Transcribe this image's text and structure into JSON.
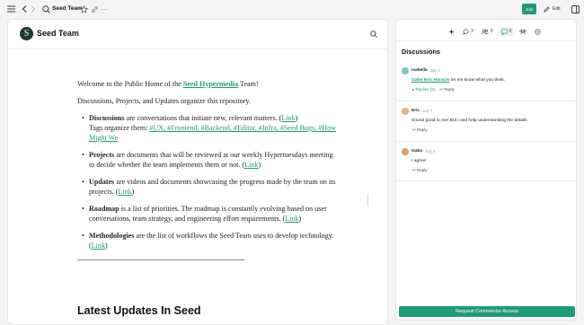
{
  "topbar": {
    "title": "Seed Team",
    "join_label": "Join",
    "edit_label": "Edit"
  },
  "header": {
    "logo_letter": "S",
    "site_name": "Seed Team"
  },
  "doc": {
    "intro_prefix": "Welcome to the Public Home of the ",
    "intro_link": "Seed Hypermedia",
    "intro_suffix": " Team!",
    "subtitle": "Discussions, Projects, and Updates organize this repository.",
    "items": [
      {
        "term": "Discussions",
        "text": " are conversations that initiate new, relevant matters. (",
        "link": "Link",
        "after": ")"
      },
      {
        "term": "Projects",
        "text": " are documents that will be reviewed at our weekly Hypertuesdays meeting to decide whether the team implements them or not. (",
        "link": "Link",
        "after": ")"
      },
      {
        "term": "Updates",
        "text": " are videos and documents showcasing the progress made by the team on its projects. (",
        "link": "Link",
        "after": ")"
      },
      {
        "term": "Roadmap",
        "text": " is a list of priorities. The roadmap is constantly evolving based on user conversations, team strategy, and engineering effort requirements. (",
        "link": "Link",
        "after": ")"
      },
      {
        "term": "Methodologies",
        "text": " are the list of workflows the Seed Team uses to develop technology. (",
        "link": "Link",
        "after": ")"
      }
    ],
    "tags_prefix": "Tags organize them: ",
    "tags": "#UX, #Frontend, #Backend, #Editor, #Infra, #Seed Bugs, #How Might We",
    "latest_heading": "Latest Updates In Seed"
  },
  "side": {
    "stats": [
      {
        "icon": "comment-icon",
        "count": "3"
      },
      {
        "icon": "users-icon",
        "count": "9"
      },
      {
        "icon": "discussion-icon",
        "count": "6"
      }
    ],
    "title": "Discussions",
    "comments": [
      {
        "name": "Isabella",
        "date": "July 1",
        "mention": "Gabo Eric Horacio",
        "body": " let me know what you think.",
        "replies": "Replies (2)",
        "reply": "Reply",
        "avatar_color": "#7cc7c0"
      },
      {
        "name": "Eric",
        "date": "July 7",
        "body": "Sound good to me! But I sed help understanding the details.",
        "reply": "Reply",
        "avatar_color": "#e2b27a"
      },
      {
        "name": "Gabo",
        "date": "July 9",
        "body": "I agree!",
        "reply": "Reply",
        "avatar_color": "#d9a07a"
      }
    ],
    "request_label": "Request Commentor Access"
  }
}
